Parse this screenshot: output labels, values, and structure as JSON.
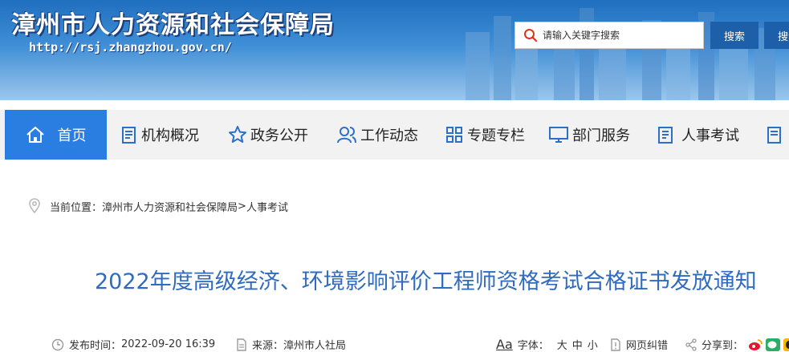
{
  "header": {
    "title": "漳州市人力资源和社会保障局",
    "url": "http://rsj.zhangzhou.gov.cn/",
    "search_placeholder": "请输入关键字搜索",
    "search_button": "搜索",
    "search_button_2": "搜索"
  },
  "nav": {
    "items": [
      {
        "label": "首页",
        "icon": "home-icon"
      },
      {
        "label": "机构概况",
        "icon": "document-list-icon"
      },
      {
        "label": "政务公开",
        "icon": "star-icon"
      },
      {
        "label": "工作动态",
        "icon": "users-icon"
      },
      {
        "label": "专题专栏",
        "icon": "grid-icon"
      },
      {
        "label": "部门服务",
        "icon": "monitor-icon"
      },
      {
        "label": "人事考试",
        "icon": "notebook-icon"
      }
    ]
  },
  "breadcrumb": {
    "prefix": "当前位置：",
    "path1": "漳州市人力资源和社会保障局",
    "sep": ">",
    "path2": "人事考试"
  },
  "article": {
    "title": "2022年度高级经济、环境影响评价工程师资格考试合格证书发放通知"
  },
  "meta": {
    "publish_label": "发布时间：",
    "publish_time": "2022-09-20 16:39",
    "source_label": "来源：",
    "source": "漳州市人社局",
    "font_label": "字体：",
    "font_large": "大",
    "font_medium": "中",
    "font_small": "小",
    "font_icon_text": "Aa",
    "correction": "网页纠错",
    "share": "分享到："
  },
  "colors": {
    "accent": "#2a7de1",
    "title_blue": "#2f6bbf",
    "search_button": "#1d5fa8"
  }
}
